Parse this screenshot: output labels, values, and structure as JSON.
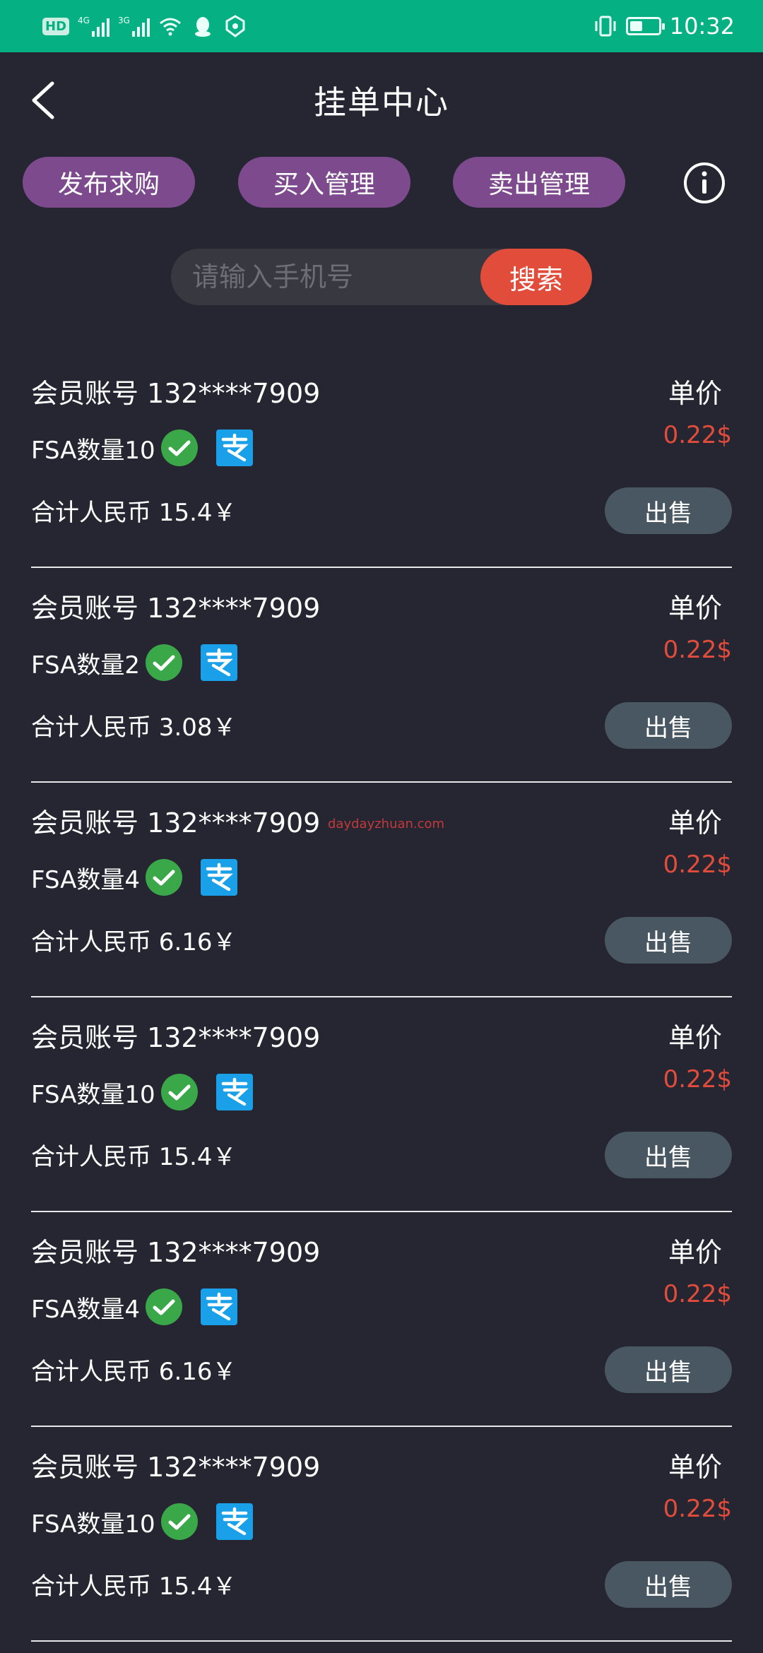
{
  "status_bar": {
    "hd": "HD",
    "net1": "4G",
    "net2": "3G",
    "time": "10:32",
    "battery_level": 0.45,
    "icons": [
      "wifi-icon",
      "qq-icon",
      "shield-icon",
      "vibrate-icon",
      "battery-icon"
    ]
  },
  "header": {
    "title": "挂单中心",
    "back_icon": "back-arrow-icon"
  },
  "actions": {
    "publish": "发布求购",
    "buy_manage": "买入管理",
    "sell_manage": "卖出管理",
    "info_icon": "info-icon"
  },
  "search": {
    "placeholder": "请输入手机号",
    "value": "",
    "button": "搜索"
  },
  "watermark": "daydayzhuan.com",
  "colors": {
    "status_bar": "#05b083",
    "background": "#252632",
    "pill": "#7d4a8d",
    "accent_red": "#e24c3b",
    "sell_button": "#495762"
  },
  "orders": [
    {
      "member": "会员账号 132****7909",
      "price_label": "单价",
      "qty": "FSA数量10",
      "price": "0.22$",
      "total": "合计人民币 15.4￥",
      "sell": "出售"
    },
    {
      "member": "会员账号 132****7909",
      "price_label": "单价",
      "qty": "FSA数量2",
      "price": "0.22$",
      "total": "合计人民币 3.08￥",
      "sell": "出售"
    },
    {
      "member": "会员账号 132****7909",
      "price_label": "单价",
      "qty": "FSA数量4",
      "price": "0.22$",
      "total": "合计人民币 6.16￥",
      "sell": "出售"
    },
    {
      "member": "会员账号 132****7909",
      "price_label": "单价",
      "qty": "FSA数量10",
      "price": "0.22$",
      "total": "合计人民币 15.4￥",
      "sell": "出售"
    },
    {
      "member": "会员账号 132****7909",
      "price_label": "单价",
      "qty": "FSA数量4",
      "price": "0.22$",
      "total": "合计人民币 6.16￥",
      "sell": "出售"
    },
    {
      "member": "会员账号 132****7909",
      "price_label": "单价",
      "qty": "FSA数量10",
      "price": "0.22$",
      "total": "合计人民币 15.4￥",
      "sell": "出售"
    }
  ]
}
